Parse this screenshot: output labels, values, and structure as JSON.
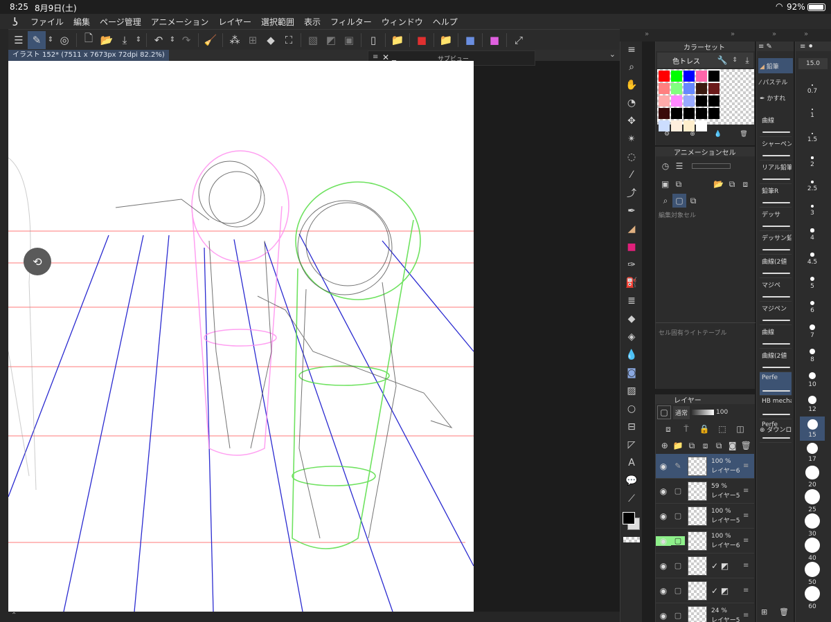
{
  "status": {
    "time": "8:25",
    "date": "8月9日(土)",
    "battery": "92%"
  },
  "menu": [
    "ファイル",
    "編集",
    "ページ管理",
    "アニメーション",
    "レイヤー",
    "選択範囲",
    "表示",
    "フィルター",
    "ウィンドウ",
    "ヘルプ"
  ],
  "document_tab": "イラスト 152* (7511 x 7673px 72dpi 82.2%)",
  "subview_title": "サブビュー",
  "color_set": {
    "title": "カラーセット",
    "set_name": "色トレス",
    "colors": [
      "#ff0000",
      "#00ff00",
      "#0000ff",
      "#ff66aa",
      "#000000",
      "#ff8080",
      "#80ff80",
      "#6688ff",
      "#3a1a10",
      "#6b1a1a",
      "#ffaaaa",
      "#ff88ff",
      "#99aaff",
      "#000000",
      "#000000",
      "#3a0a0a",
      "#000000",
      "#000000",
      "#000000",
      "#000000",
      "#ccddff",
      "#ffeedd",
      "#ffeecc",
      "#ffffff",
      "#000000"
    ]
  },
  "animation_cel": {
    "title": "アニメーションセル",
    "edit_label": "編集対象セル",
    "lighttable_label": "セル固有ライトテーブル"
  },
  "layer_panel": {
    "title": "レイヤー",
    "blend_mode": "通常",
    "opacity": "100",
    "layers": [
      {
        "opacity": "100 %",
        "name": "レイヤー6",
        "selected": true
      },
      {
        "opacity": "59 %",
        "name": "レイヤー5",
        "selected": false
      },
      {
        "opacity": "100 %",
        "name": "レイヤー5",
        "selected": false
      },
      {
        "opacity": "100 %",
        "name": "レイヤー6",
        "selected": false,
        "green": true
      },
      {
        "opacity": "",
        "name": "",
        "selected": false,
        "folder": true
      },
      {
        "opacity": "",
        "name": "",
        "selected": false,
        "folder": true
      },
      {
        "opacity": "24 %",
        "name": "レイヤー5",
        "selected": false
      }
    ]
  },
  "brush_tabs": [
    "鉛筆",
    "パステル",
    "かすれ"
  ],
  "brushes": [
    "曲線",
    "シャーペン",
    "リアル鉛筆",
    "鉛筆R",
    "デッサ",
    "デッサン鉛",
    "曲線(2値",
    "マジペ",
    "マジペン",
    "曲線",
    "曲線(2値",
    "Perfe",
    "HB mecha",
    "Perfe"
  ],
  "download_label": "ダウンロード",
  "brush_sizes": [
    "15.0",
    "0.7",
    "1",
    "1.5",
    "2",
    "2.5",
    "3",
    "4",
    "4.5",
    "5",
    "6",
    "7",
    "8",
    "10",
    "12",
    "15",
    "17",
    "20",
    "25",
    "30",
    "40",
    "50",
    "60"
  ],
  "selected_size": "15"
}
